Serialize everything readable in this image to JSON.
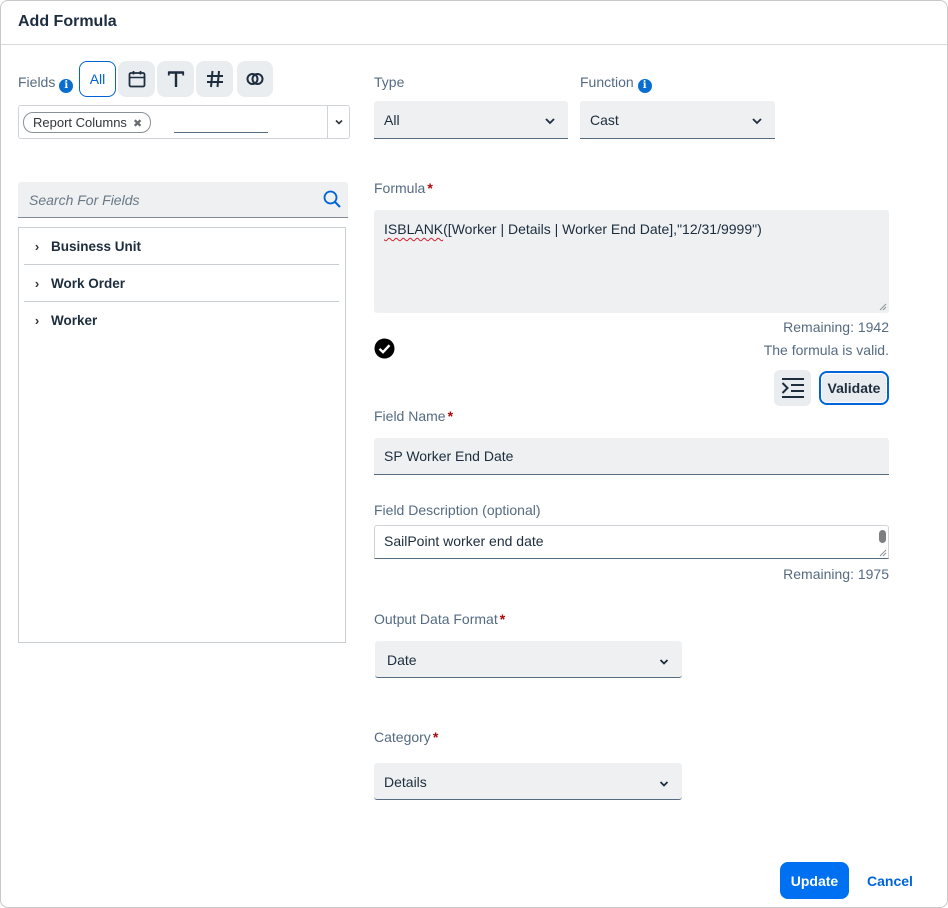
{
  "dialog": {
    "title": "Add Formula"
  },
  "fields": {
    "label": "Fields",
    "filters": [
      {
        "name": "all",
        "label": "All",
        "active": true
      },
      {
        "name": "date",
        "icon": "calendar-icon"
      },
      {
        "name": "text",
        "icon": "text-type-icon"
      },
      {
        "name": "number",
        "icon": "hash-icon"
      },
      {
        "name": "boolean",
        "icon": "boolean-icon"
      }
    ],
    "token": "Report Columns",
    "search_placeholder": "Search For Fields",
    "tree": [
      {
        "label": "Business Unit"
      },
      {
        "label": "Work Order"
      },
      {
        "label": "Worker"
      }
    ]
  },
  "type": {
    "label": "Type",
    "value": "All"
  },
  "function": {
    "label": "Function",
    "value": "Cast"
  },
  "formula": {
    "label": "Formula",
    "value_prefix": "ISBLANK",
    "value_rest": "([Worker | Details | Worker End Date],\"12/31/9999\")",
    "remaining": "Remaining: 1942",
    "status": "The formula is valid.",
    "validate_label": "Validate"
  },
  "field_name": {
    "label": "Field Name",
    "value": "SP Worker End Date"
  },
  "field_description": {
    "label": "Field Description (optional)",
    "value": "SailPoint worker end date",
    "remaining": "Remaining: 1975"
  },
  "output_format": {
    "label": "Output Data Format",
    "value": "Date"
  },
  "category": {
    "label": "Category",
    "value": "Details"
  },
  "footer": {
    "update_label": "Update",
    "cancel_label": "Cancel"
  },
  "colors": {
    "accent": "#0070f2",
    "required": "#aa0808"
  }
}
